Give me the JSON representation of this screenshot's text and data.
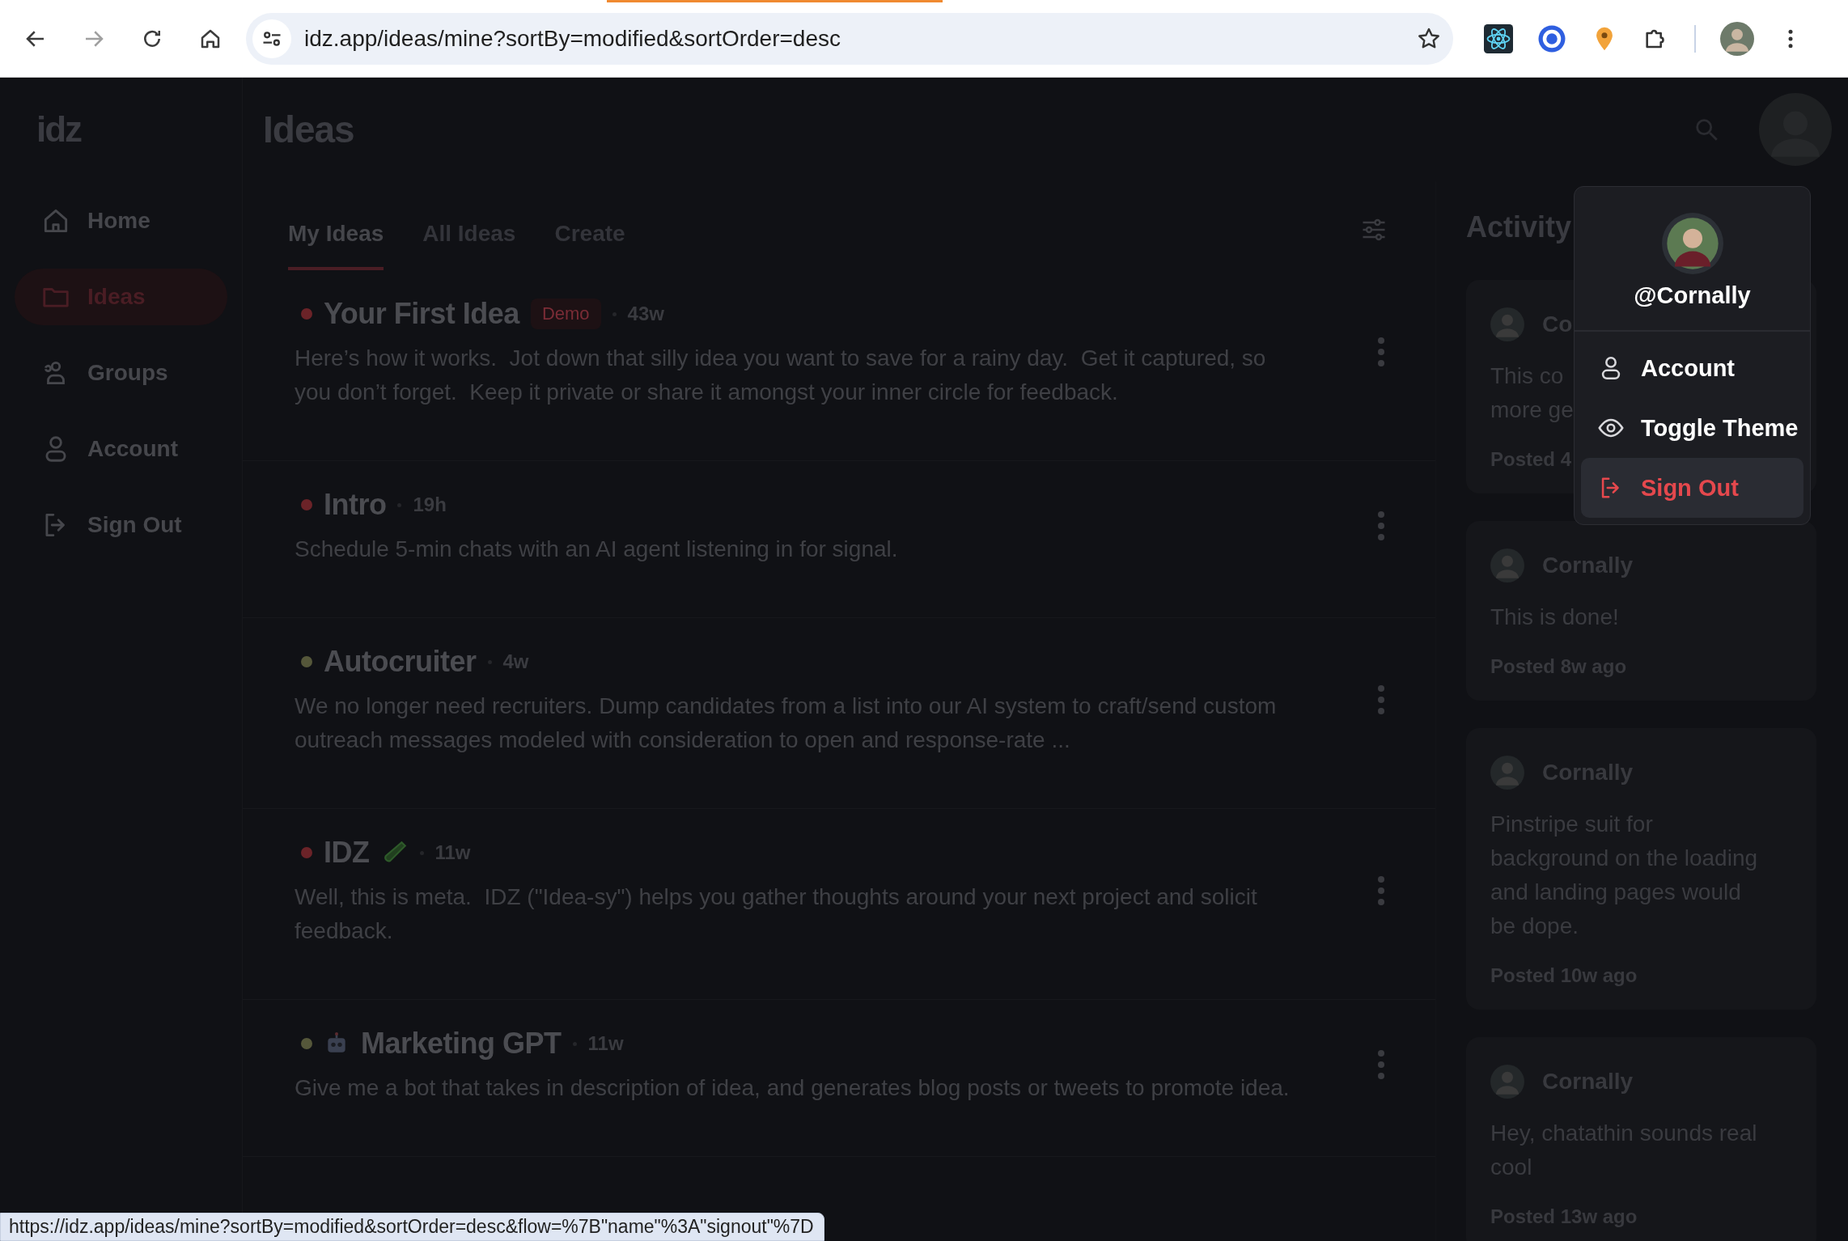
{
  "browser": {
    "url": "idz.app/ideas/mine?sortBy=modified&sortOrder=desc",
    "status_url": "https://idz.app/ideas/mine?sortBy=modified&sortOrder=desc&flow=%7B\"name\"%3A\"signout\"%7D"
  },
  "app": {
    "logo": "idz",
    "page_title": "Ideas"
  },
  "sidebar": {
    "items": [
      {
        "label": "Home",
        "selected": false
      },
      {
        "label": "Ideas",
        "selected": true
      },
      {
        "label": "Groups",
        "selected": false
      },
      {
        "label": "Account",
        "selected": false
      },
      {
        "label": "Sign Out",
        "selected": false
      }
    ]
  },
  "tabs": [
    {
      "label": "My Ideas",
      "selected": true
    },
    {
      "label": "All Ideas",
      "selected": false
    },
    {
      "label": "Create",
      "selected": false
    }
  ],
  "ideas": [
    {
      "title": "Your First Idea",
      "color": "#6b2328",
      "badge": "Demo",
      "age": "43w",
      "description": "Here’s how it works.  Jot down that silly idea you want to save for a rainy day.  Get it captured, so you don’t forget.  Keep it private or share it amongst your inner circle for feedback."
    },
    {
      "title": "Intro",
      "color": "#6b2328",
      "age": "19h",
      "description": "Schedule 5-min chats with an AI agent listening in for signal."
    },
    {
      "title": "Autocruiter",
      "color": "#55573a",
      "age": "4w",
      "description": "We no longer need recruiters. Dump candidates from a list into our AI system to craft/send custom outreach messages modeled with consideration to open and response-rate ..."
    },
    {
      "title": "IDZ",
      "color": "#6b2328",
      "age": "11w",
      "description": "Well, this is meta.  IDZ (\"Idea-sy\") helps you gather thoughts around your next project and solicit feedback."
    },
    {
      "title": "Marketing GPT",
      "color": "#55573a",
      "age": "11w",
      "description": "Give me a bot that takes in description of idea, and generates blog posts or tweets to promote idea."
    }
  ],
  "activity": {
    "title": "Activity",
    "cards": [
      {
        "author": "Co",
        "body_lines": [
          "This co",
          "more ge"
        ],
        "posted": "Posted 4"
      },
      {
        "author": "Cornally",
        "body_lines": [
          "This is done!"
        ],
        "posted": "Posted 8w ago"
      },
      {
        "author": "Cornally",
        "body_lines": [
          "Pinstripe suit for",
          "background on the loading",
          "and landing pages would",
          "be dope."
        ],
        "posted": "Posted 10w ago"
      },
      {
        "author": "Cornally",
        "body_lines": [
          "Hey, chatathin sounds real",
          "cool"
        ],
        "posted": "Posted 13w ago"
      }
    ]
  },
  "user_menu": {
    "handle": "@Cornally",
    "items": [
      {
        "label": "Account",
        "kind": "normal",
        "selected": false
      },
      {
        "label": "Toggle Theme",
        "kind": "normal",
        "selected": false
      },
      {
        "label": "Sign Out",
        "kind": "danger",
        "selected": true
      }
    ]
  }
}
